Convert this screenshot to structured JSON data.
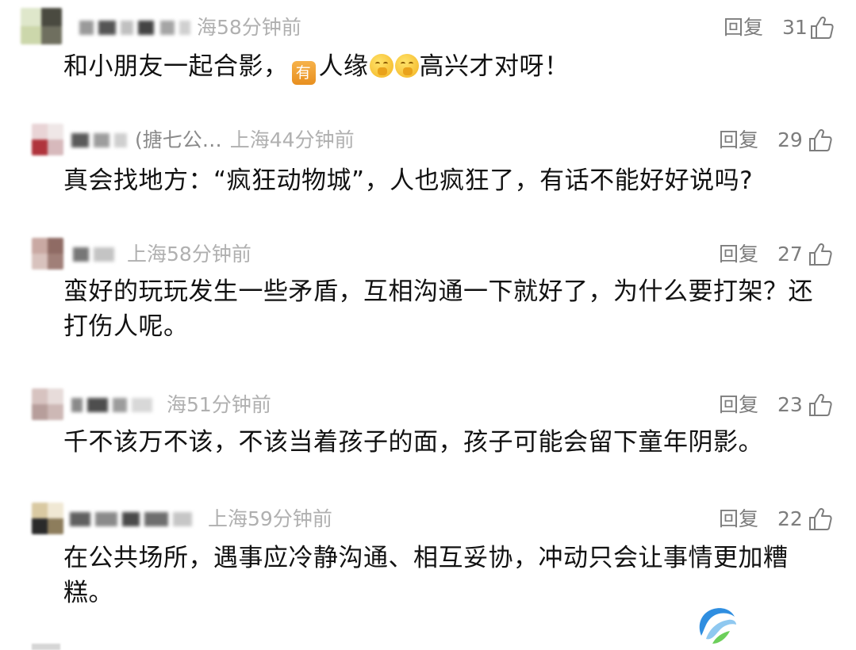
{
  "comments": [
    {
      "partial_name": "",
      "location": "海",
      "time": "58分钟前",
      "reply_label": "回复",
      "likes": "31",
      "text_before": "和小朋友一起合影，",
      "tag_label": "有",
      "text_mid": "人缘",
      "text_after": "高兴才对呀！"
    },
    {
      "partial_name": "(搪七公…",
      "location": "上海",
      "time": "44分钟前",
      "reply_label": "回复",
      "likes": "29",
      "text": "真会找地方：“疯狂动物城”，人也疯狂了，有话不能好好说吗?"
    },
    {
      "partial_name": "",
      "location": "上海",
      "time": "58分钟前",
      "reply_label": "回复",
      "likes": "27",
      "text": "蛮好的玩玩发生一些矛盾，互相沟通一下就好了，为什么要打架？还打伤人呢。"
    },
    {
      "partial_name": "",
      "location": "海",
      "time": "51分钟前",
      "reply_label": "回复",
      "likes": "23",
      "text": "千不该万不该，不该当着孩子的面，孩子可能会留下童年阴影。"
    },
    {
      "partial_name": "",
      "location": "上海",
      "time": "59分钟前",
      "reply_label": "回复",
      "likes": "22",
      "text": "在公共场所，遇事应冷静沟通、相互妥协，冲动只会让事情更加糟糕。"
    }
  ],
  "icons": {
    "like": "thumbs-up-icon",
    "emoji": "hmm-face-icon",
    "logo": "watermark-logo-icon"
  },
  "colors": {
    "meta_gray": "#b0b0b0",
    "action_gray": "#7d7d7d",
    "text": "#121212",
    "tag_orange": "#f2a33a",
    "logo_blue": "#2f8ee0",
    "logo_green": "#6ccf5a"
  }
}
